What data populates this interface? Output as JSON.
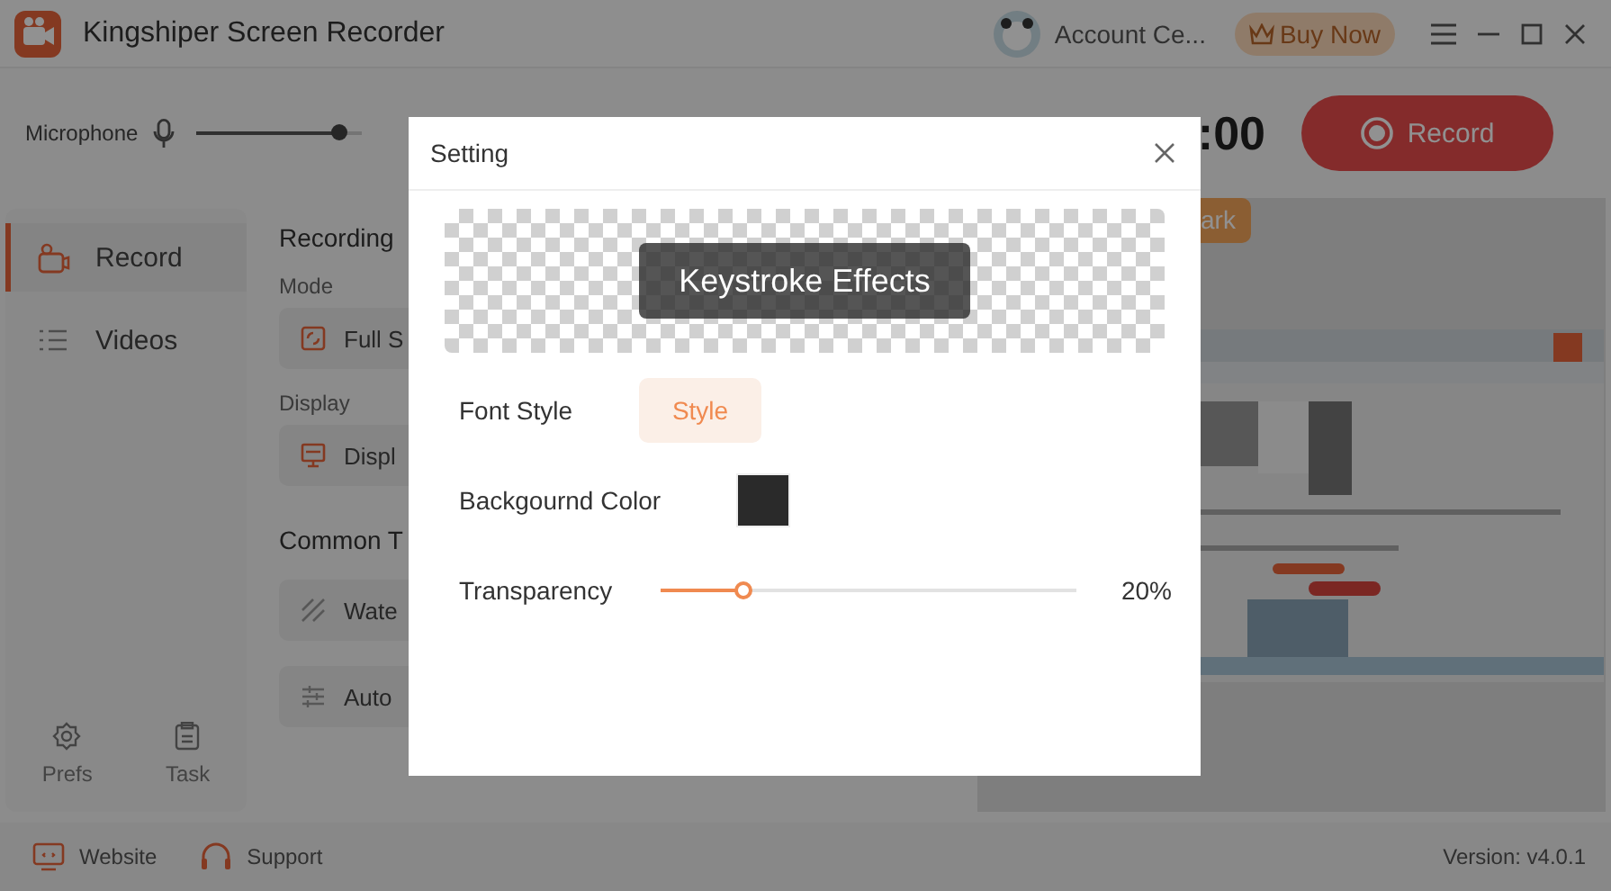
{
  "window": {
    "title": "Kingshiper Screen Recorder"
  },
  "header": {
    "account": "Account Ce...",
    "buy": "Buy Now"
  },
  "toolbar": {
    "microphone": {
      "label": "Microphone",
      "level": 0.87
    },
    "timer": ":00",
    "record": "Record"
  },
  "sidebar": {
    "items": [
      {
        "label": "Record",
        "selected": true
      },
      {
        "label": "Videos",
        "selected": false
      }
    ],
    "bottom": [
      "Prefs",
      "Task"
    ]
  },
  "content": {
    "title": "Recording",
    "groups": [
      {
        "label": "Mode",
        "value": "Full S"
      },
      {
        "label": "Display",
        "value": "Displ"
      }
    ],
    "tools_title": "Common T",
    "tools": [
      "Wate",
      "Auto"
    ]
  },
  "preview": {
    "badge": "ark"
  },
  "footer": {
    "links": [
      "Website",
      "Support"
    ],
    "version": "Version: v4.0.1"
  },
  "dialog": {
    "title": "Setting",
    "preview_text": "Keystroke Effects",
    "font_style": {
      "label": "Font Style",
      "button": "Style"
    },
    "background_color": {
      "label": "Backgournd Color",
      "color": "#2a2a2a"
    },
    "transparency": {
      "label": "Transparency",
      "level": 0.2,
      "reading": "20%"
    }
  }
}
